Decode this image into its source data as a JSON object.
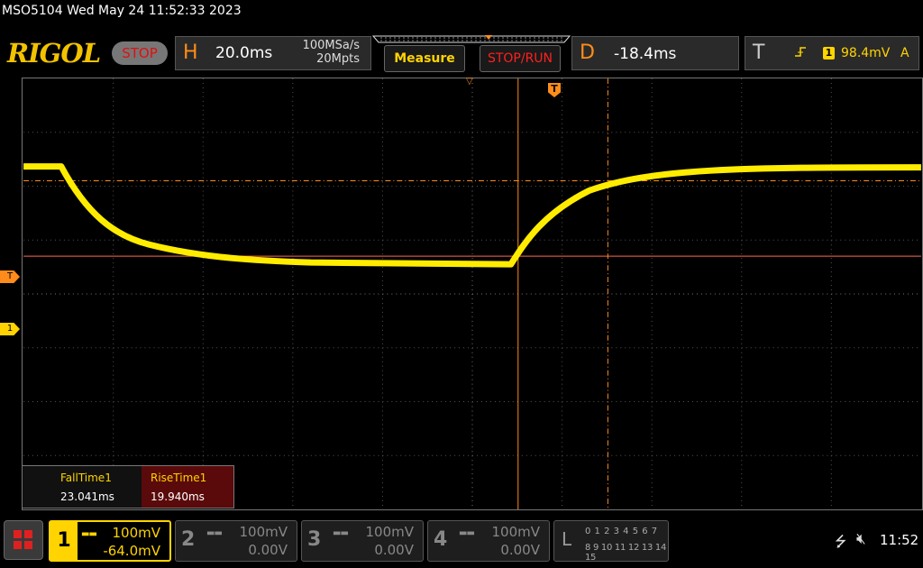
{
  "header": {
    "device_line": "MSO5104  Wed May 24 11:52:33 2023",
    "logo": "RIGOL",
    "run_state": "STOP"
  },
  "horizontal": {
    "letter": "H",
    "timebase": "20.0ms",
    "sample_rate": "100MSa/s",
    "memory_depth": "20Mpts"
  },
  "buttons": {
    "measure": "Measure",
    "stop_run": "STOP/RUN"
  },
  "delay": {
    "letter": "D",
    "value": "-18.4ms"
  },
  "trigger": {
    "letter": "T",
    "edge_icon": "rising-edge-icon",
    "source": "1",
    "level": "98.4mV",
    "mode": "A"
  },
  "markers": {
    "trigger_level": "T",
    "ch1_ground": "1",
    "trigger_position": "T"
  },
  "measurements": [
    {
      "name": "FallTime1",
      "value": "23.041ms"
    },
    {
      "name": "RiseTime1",
      "value": "19.940ms"
    }
  ],
  "channels": [
    {
      "num": "1",
      "scale": "100mV",
      "offset": "-64.0mV",
      "active": true
    },
    {
      "num": "2",
      "scale": "100mV",
      "offset": "0.00V",
      "active": false
    },
    {
      "num": "3",
      "scale": "100mV",
      "offset": "0.00V",
      "active": false
    },
    {
      "num": "4",
      "scale": "100mV",
      "offset": "0.00V",
      "active": false
    }
  ],
  "logic": {
    "letter": "L",
    "row1": "0 1 2 3  4 5 6 7",
    "row2": "8 9 10 11 12 13 14 15"
  },
  "status": {
    "clock": "11:52"
  },
  "colors": {
    "ch1": "#ffd400",
    "accent": "#ff8c1a",
    "stop": "#ff2020"
  }
}
